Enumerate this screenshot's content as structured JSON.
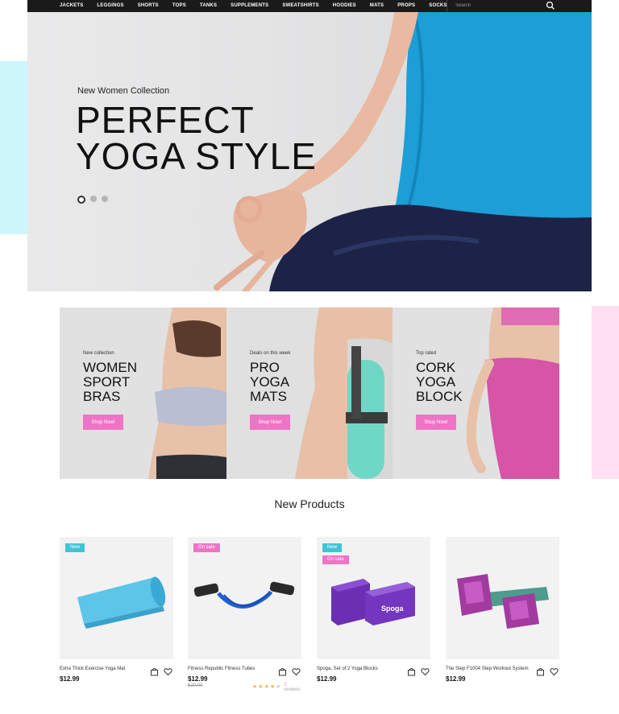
{
  "nav": {
    "items": [
      "JACKETS",
      "LEGGINGS",
      "SHORTS",
      "TOPS",
      "TANKS",
      "SUPPLEMENTS",
      "SWEATSHIRTS",
      "HOODIES",
      "MATS",
      "PROPS",
      "SOCKS"
    ],
    "search_placeholder": "Search"
  },
  "hero": {
    "subtitle": "New Women Collection",
    "title_line1": "PERFECT",
    "title_line2": "YOGA STYLE",
    "dots_count": 3,
    "active_dot": 0
  },
  "promos": [
    {
      "label": "New collection",
      "title": [
        "WOMEN",
        "SPORT",
        "BRAS"
      ],
      "button": "Shop Now!"
    },
    {
      "label": "Deals on this week",
      "title": [
        "PRO",
        "YOGA",
        "MATS"
      ],
      "button": "Shop Now!"
    },
    {
      "label": "Top rated",
      "title": [
        "CORK",
        "YOGA",
        "BLOCK"
      ],
      "button": "Shop Now!"
    }
  ],
  "products_section": {
    "title": "New Products"
  },
  "products": [
    {
      "name": "Extra Thick Exercise Yoga Mat",
      "price": "$12.99",
      "old_price": null,
      "badges": [
        "New"
      ],
      "rating": null,
      "reviews": null
    },
    {
      "name": "Fitness Republic Fitness Tubes",
      "price": "$12.99",
      "old_price": "$20.00",
      "badges": [
        "On sale"
      ],
      "rating": 4,
      "reviews": "2 reviews"
    },
    {
      "name": "Spoga, Set of 2 Yoga Blocks",
      "price": "$12.99",
      "old_price": null,
      "badges": [
        "New",
        "On sale"
      ],
      "rating": null,
      "reviews": null
    },
    {
      "name": "The Step F1004 Step Workout System",
      "price": "$12.99",
      "old_price": null,
      "badges": [],
      "rating": null,
      "reviews": null
    }
  ],
  "colors": {
    "nav_bg": "#1a1a1a",
    "accent_pink": "#ee74c6",
    "accent_teal": "#3cc6d6",
    "deco_blue": "#cdf6fb",
    "deco_pink": "#fde0f1"
  }
}
